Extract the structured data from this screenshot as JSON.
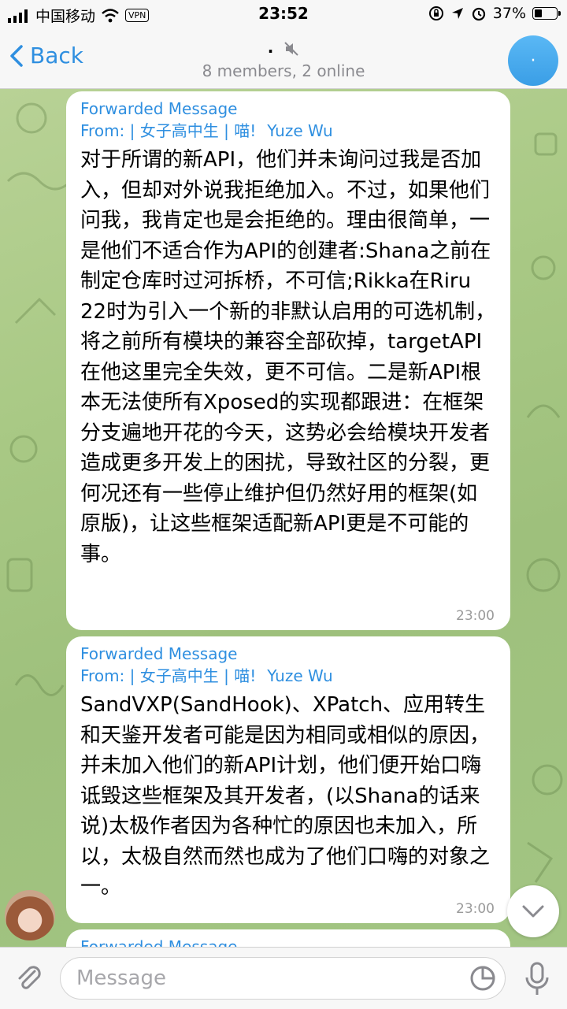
{
  "status_bar": {
    "carrier": "中国移动",
    "vpn": "VPN",
    "time": "23:52",
    "battery": "37%"
  },
  "nav": {
    "back_label": "Back",
    "title": ".",
    "subtitle": "8 members, 2 online",
    "avatar_text": "·"
  },
  "messages": [
    {
      "forwarded_label": "Forwarded Message",
      "from_prefix": "From: | 女子高中生 | 喵!",
      "from_name": "Yuze Wu",
      "text": "对于所谓的新API，他们并未询问过我是否加入，但却对外说我拒绝加入。不过，如果他们问我，我肯定也是会拒绝的。理由很简单，一是他们不适合作为API的创建者:Shana之前在制定仓库时过河拆桥，不可信;Rikka在Riru 22时为引入一个新的非默认启用的可选机制，将之前所有模块的兼容全部砍掉，targetAPI在他这里完全失效，更不可信。二是新API根本无法使所有Xposed的实现都跟进：在框架分支遍地开花的今天，这势必会给模块开发者造成更多开发上的困扰，导致社区的分裂，更何况还有一些停止维护但仍然好用的框架(如原版)，让这些框架适配新API更是不可能的事。",
      "time": "23:00"
    },
    {
      "forwarded_label": "Forwarded Message",
      "from_prefix": "From: | 女子高中生 | 喵!",
      "from_name": "Yuze Wu",
      "text": "SandVXP(SandHook)、XPatch、应用转生和天鉴开发者可能是因为相同或相似的原因，并未加入他们的新API计划，他们便开始口嗨诋毁这些框架及其开发者，(以Shana的话来说)太极作者因为各种忙的原因也未加入，所以，太极自然而然也成为了他们口嗨的对象之一。",
      "time": "23:00"
    },
    {
      "forwarded_label": "Forwarded Message"
    }
  ],
  "input": {
    "placeholder": "Message"
  },
  "colors": {
    "accent": "#2f8fe0",
    "bubble": "#ffffff",
    "bar": "#f7f7f7"
  }
}
